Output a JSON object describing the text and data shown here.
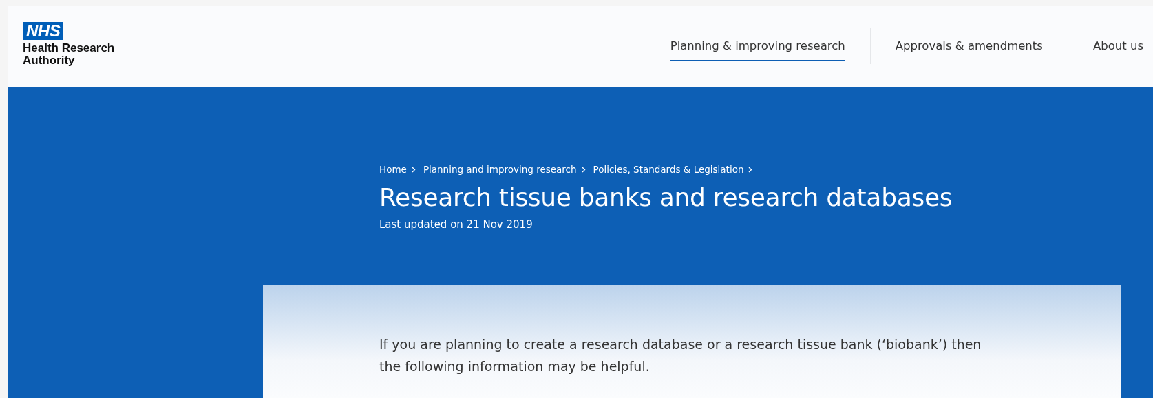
{
  "header": {
    "logo": {
      "badge": "NHS",
      "name_lines": [
        "Health Research",
        "Authority"
      ]
    },
    "nav": [
      {
        "label": "Planning & improving research",
        "selected": true
      },
      {
        "label": "Approvals & amendments",
        "selected": false
      },
      {
        "label": "About us",
        "selected": false
      }
    ]
  },
  "hero": {
    "breadcrumbs": [
      "Home",
      "Planning and improving research",
      "Policies, Standards & Legislation"
    ],
    "title": "Research tissue banks and research databases",
    "updated": "Last updated on 21 Nov 2019"
  },
  "intro": "If you are planning to create a research database or a research tissue bank (‘biobank’) then the following information may be helpful."
}
